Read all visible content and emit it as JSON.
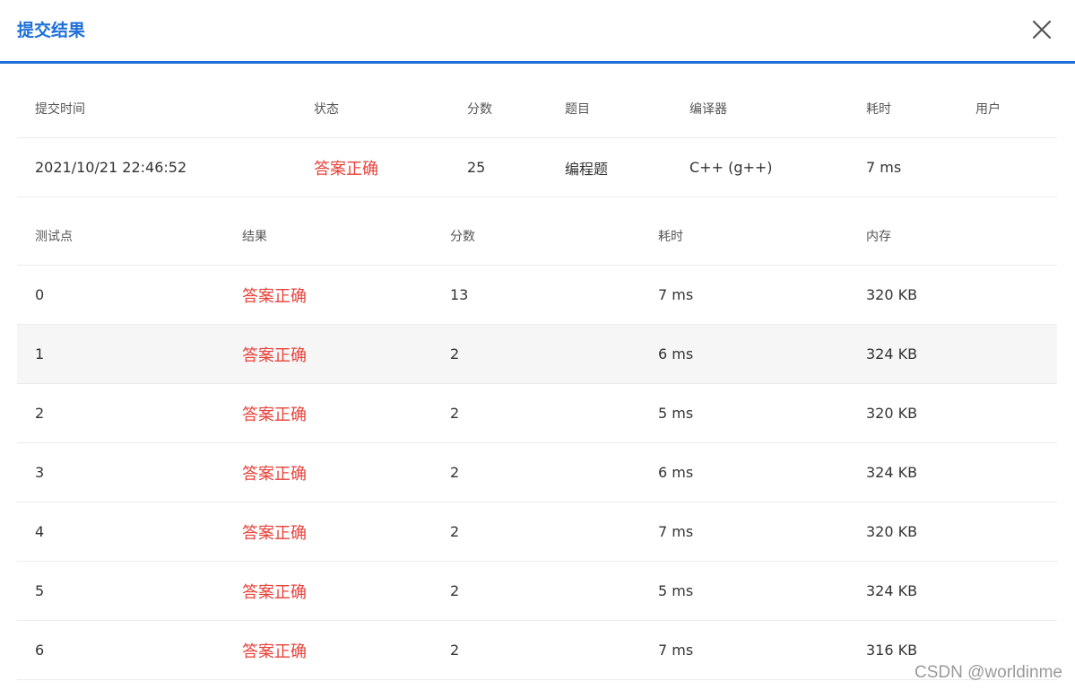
{
  "dialog": {
    "title": "提交结果"
  },
  "summary": {
    "headers": [
      "提交时间",
      "状态",
      "分数",
      "题目",
      "编译器",
      "耗时",
      "用户"
    ],
    "row": {
      "time": "2021/10/21 22:46:52",
      "status": "答案正确",
      "score": "25",
      "problem": "编程题",
      "compiler": "C++ (g++)",
      "duration": "7 ms",
      "user": ""
    }
  },
  "tests": {
    "headers": [
      "测试点",
      "结果",
      "分数",
      "耗时",
      "内存"
    ],
    "rows": [
      {
        "id": "0",
        "result": "答案正确",
        "score": "13",
        "time": "7 ms",
        "memory": "320 KB"
      },
      {
        "id": "1",
        "result": "答案正确",
        "score": "2",
        "time": "6 ms",
        "memory": "324 KB"
      },
      {
        "id": "2",
        "result": "答案正确",
        "score": "2",
        "time": "5 ms",
        "memory": "320 KB"
      },
      {
        "id": "3",
        "result": "答案正确",
        "score": "2",
        "time": "6 ms",
        "memory": "324 KB"
      },
      {
        "id": "4",
        "result": "答案正确",
        "score": "2",
        "time": "7 ms",
        "memory": "320 KB"
      },
      {
        "id": "5",
        "result": "答案正确",
        "score": "2",
        "time": "5 ms",
        "memory": "324 KB"
      },
      {
        "id": "6",
        "result": "答案正确",
        "score": "2",
        "time": "7 ms",
        "memory": "316 KB"
      }
    ]
  },
  "watermark": "CSDN @worldinme",
  "colors": {
    "accent": "#1e6fd9",
    "accepted": "#e8413a",
    "row_alt": "#f6f6f6"
  },
  "icons": {
    "close": "close-icon"
  }
}
